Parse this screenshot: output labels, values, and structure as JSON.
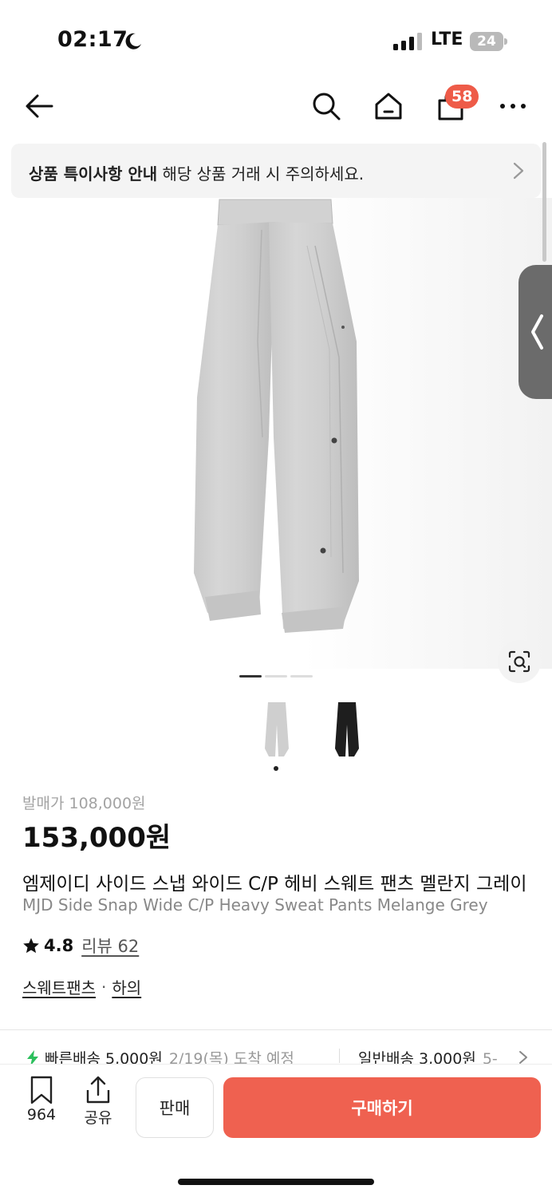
{
  "status_bar": {
    "time": "02:17",
    "network": "LTE",
    "battery": "24"
  },
  "nav": {
    "cart_count": "58",
    "icons": [
      "back-arrow-icon",
      "search-icon",
      "home-icon",
      "cart-icon",
      "more-icon"
    ]
  },
  "notice": {
    "strong": "상품 특이사항 안내",
    "text": " 해당 상품 거래 시 주의하세요."
  },
  "gallery": {
    "page_count": 3,
    "active_page": 1,
    "thumbnails": [
      "grey-pants-thumb",
      "black-pants-thumb"
    ]
  },
  "product": {
    "retail_price": "발매가 108,000원",
    "price": "153,000원",
    "title_ko": "엠제이디 사이드 스냅 와이드 C/P 헤비 스웨트 팬츠 멜란지 그레이",
    "title_en": "MJD Side Snap Wide C/P Heavy Sweat Pants Melange Grey",
    "rating": "4.8",
    "review": "리뷰 62",
    "categories": [
      "스웨트팬츠",
      "하의"
    ],
    "category_sep": "·"
  },
  "shipping": {
    "fast_label": "빠른배송 5,000원",
    "fast_date": "2/19(목) 도착 예정",
    "normal_label": "일반배송 3,000원",
    "normal_date": "5-"
  },
  "bottom_bar": {
    "save_count": "964",
    "share_label": "공유",
    "sell_label": "판매",
    "buy_label": "구매하기"
  },
  "colors": {
    "accent": "#ef6150",
    "badge": "#ee5b48",
    "fast_ship": "#2bbf5c"
  }
}
